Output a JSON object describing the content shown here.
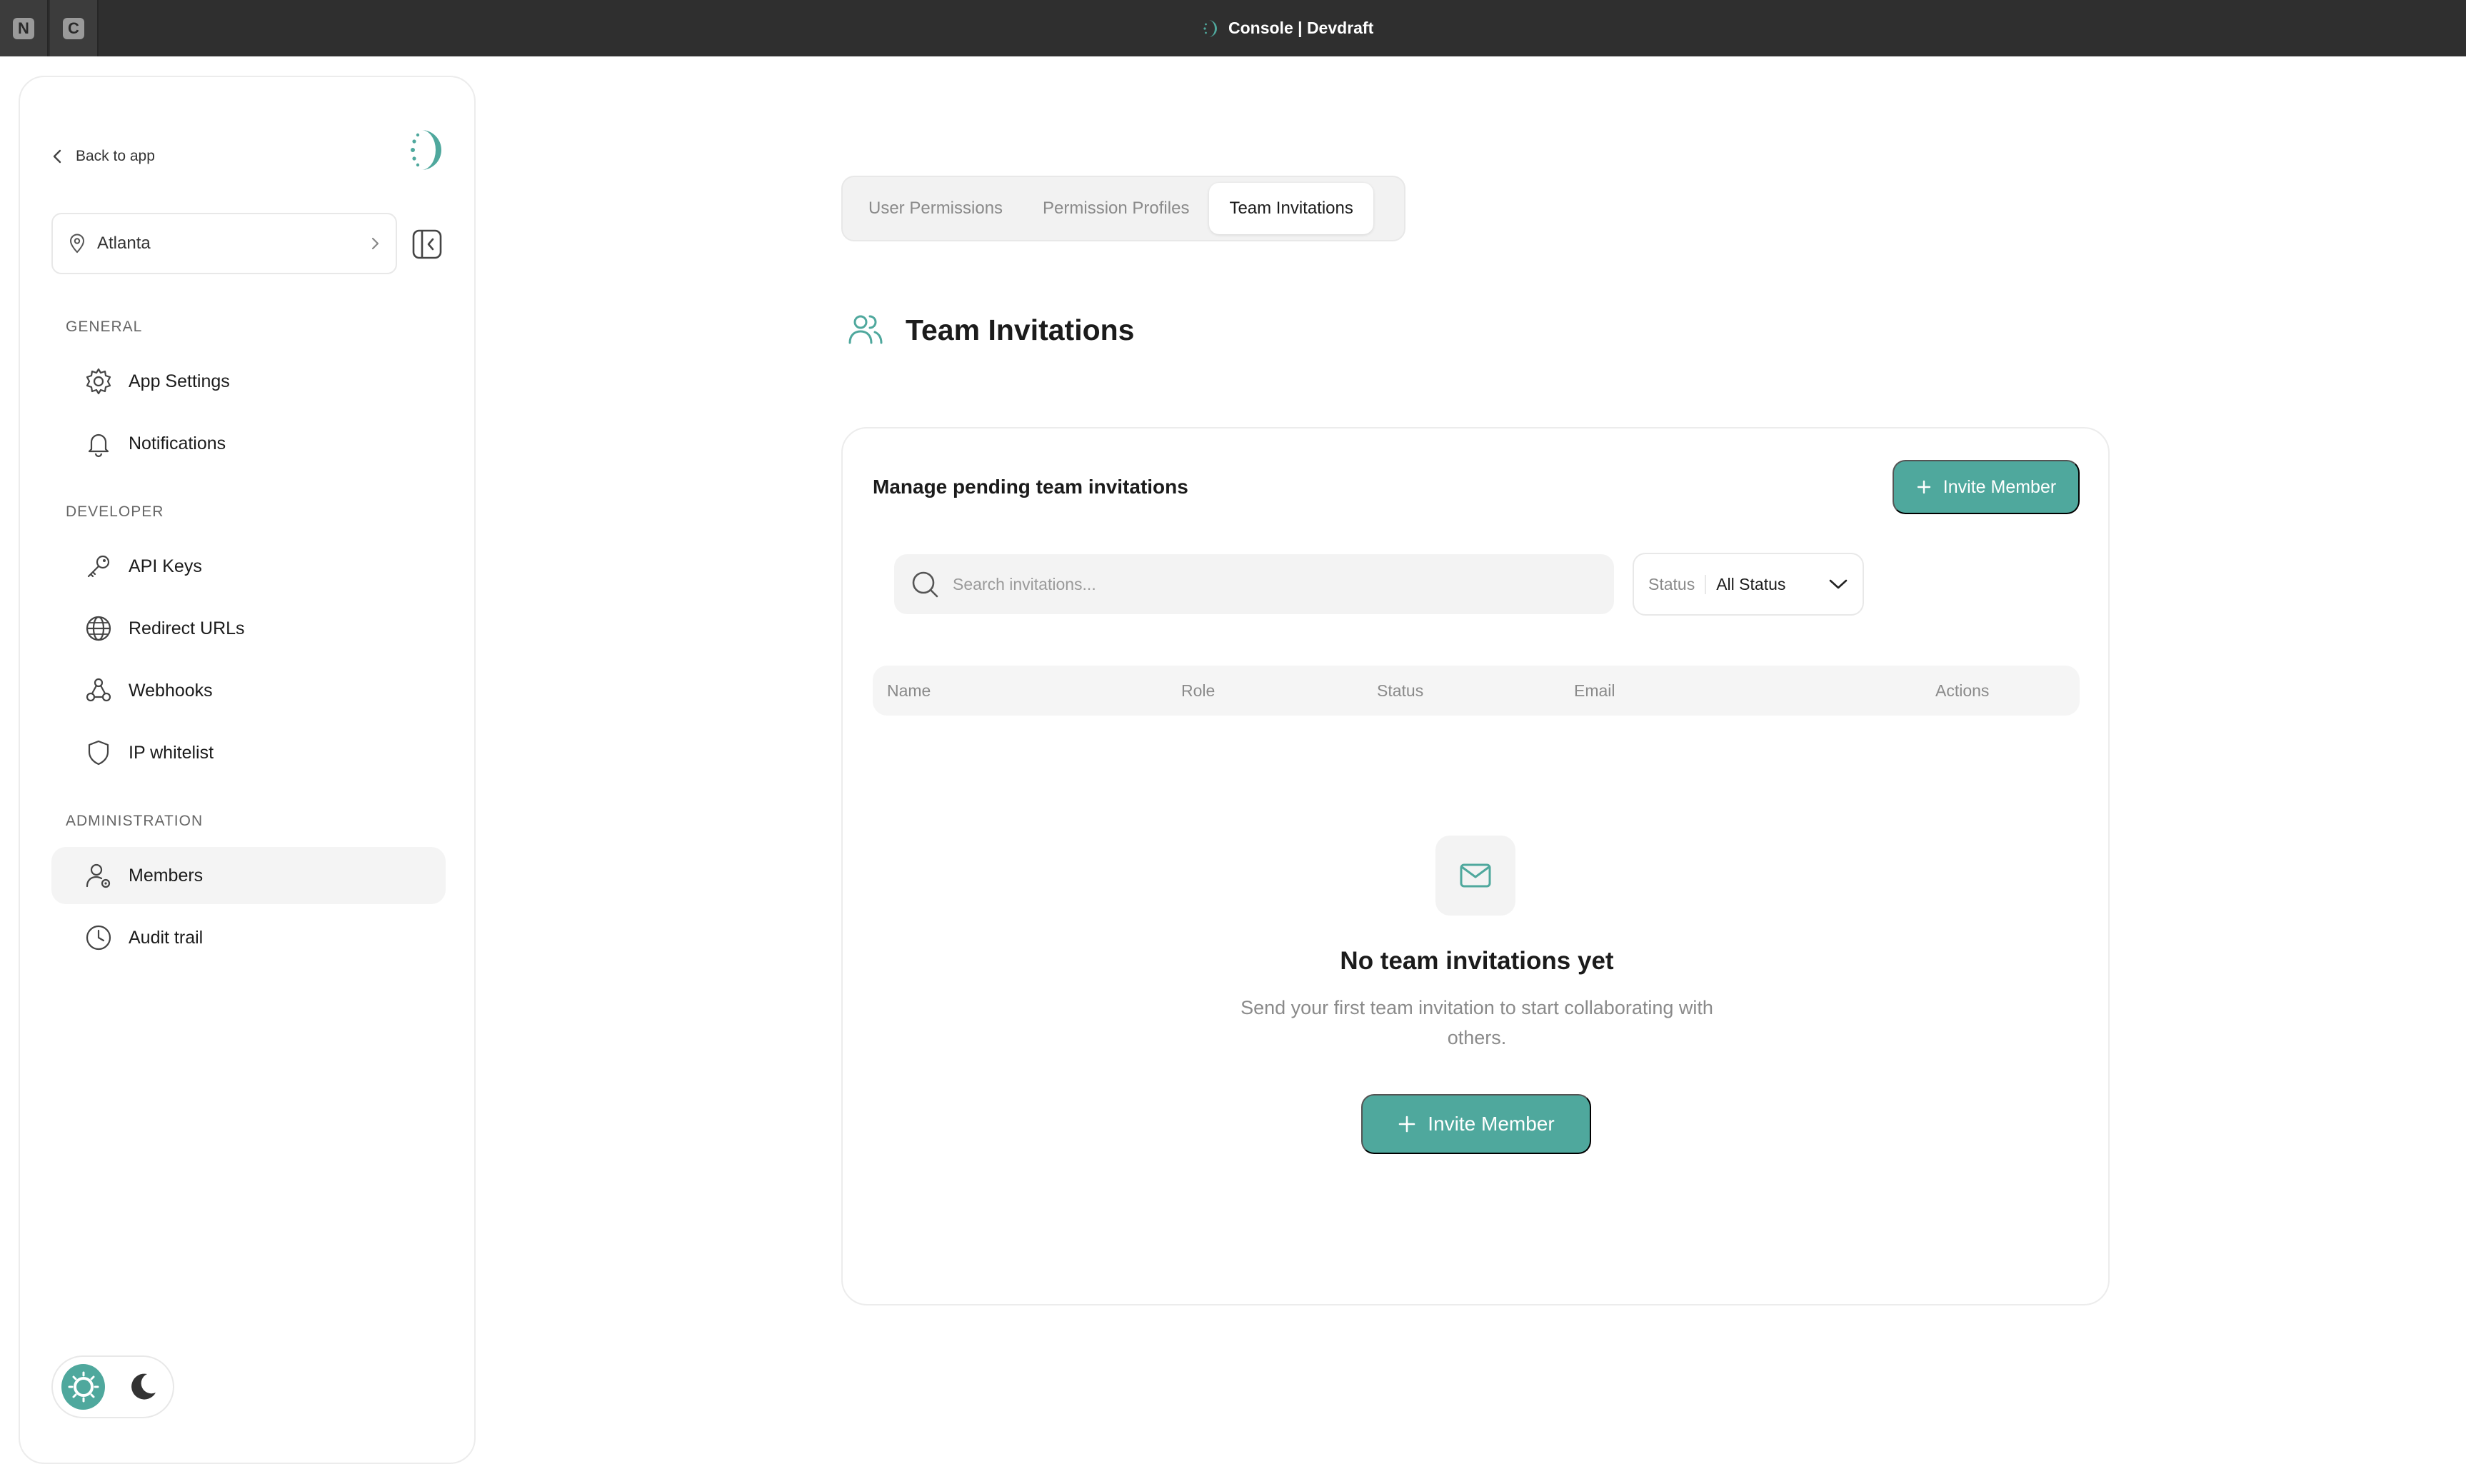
{
  "browser": {
    "tabs": [
      {
        "glyph": "N",
        "icon": "n-favicon-icon"
      },
      {
        "glyph": "C",
        "icon": "c-favicon-icon"
      }
    ],
    "window_title": "Console | Devdraft"
  },
  "sidebar": {
    "back_label": "Back to app",
    "location": "Atlanta",
    "sections": [
      {
        "label": "GENERAL",
        "items": [
          {
            "label": "App Settings",
            "icon": "gear-icon"
          },
          {
            "label": "Notifications",
            "icon": "bell-icon"
          }
        ]
      },
      {
        "label": "DEVELOPER",
        "items": [
          {
            "label": "API Keys",
            "icon": "key-icon"
          },
          {
            "label": "Redirect URLs",
            "icon": "globe-icon"
          },
          {
            "label": "Webhooks",
            "icon": "webhook-icon"
          },
          {
            "label": "IP whitelist",
            "icon": "shield-icon"
          }
        ]
      },
      {
        "label": "ADMINISTRATION",
        "items": [
          {
            "label": "Members",
            "icon": "user-settings-icon",
            "active": true
          },
          {
            "label": "Audit trail",
            "icon": "clock-icon"
          }
        ]
      }
    ],
    "theme": {
      "selected": "light",
      "options": [
        "sun-icon",
        "moon-icon"
      ]
    }
  },
  "tabs": [
    {
      "label": "User Permissions",
      "active": false
    },
    {
      "label": "Permission Profiles",
      "active": false
    },
    {
      "label": "Team Invitations",
      "active": true
    }
  ],
  "page": {
    "title": "Team Invitations",
    "card_title": "Manage pending team invitations",
    "invite_button": "Invite Member",
    "search_placeholder": "Search invitations...",
    "status_label": "Status",
    "status_value": "All Status",
    "columns": [
      "Name",
      "Role",
      "Status",
      "Email",
      "Actions"
    ],
    "empty": {
      "title": "No team invitations yet",
      "description": "Send your first team invitation to start collaborating with others.",
      "button": "Invite Member"
    }
  },
  "colors": {
    "accent": "#4fa89d",
    "titlebar": "#2f2f2f",
    "muted_text": "#8a8a8a",
    "border": "#ececec"
  }
}
